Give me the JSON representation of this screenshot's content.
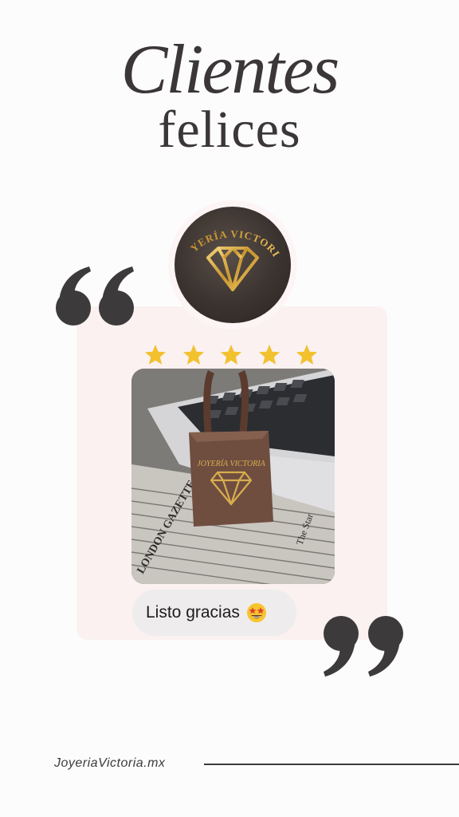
{
  "header": {
    "script_title": "Clientes",
    "main_title": "felices"
  },
  "logo": {
    "brand_text": "JOYERÍA VICTORIA",
    "icon": "diamond-icon"
  },
  "rating": {
    "stars": 5,
    "max_stars": 5,
    "star_color": "#f2c12e"
  },
  "photo": {
    "box_text": "JOYERÍA VICTORIA",
    "newspaper_text": [
      "LONDON GAZETTE",
      "The Star"
    ]
  },
  "review": {
    "message": "Listo gracias",
    "emoji": "star-struck-emoji"
  },
  "quotes": {
    "open_icon": "open-quote-icon",
    "close_icon": "close-quote-icon",
    "color": "#3c3a3a"
  },
  "footer": {
    "website": "JoyeriaVictoria.mx"
  },
  "colors": {
    "background": "#fdfcfc",
    "card": "#fbf1f1",
    "gold": "#d4a640",
    "dark_text": "#3b3638"
  }
}
